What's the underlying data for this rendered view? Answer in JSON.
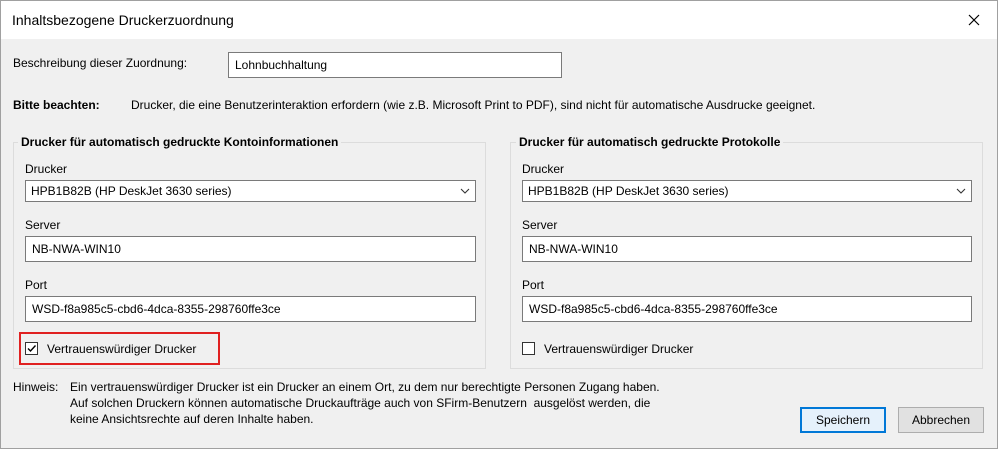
{
  "window": {
    "title": "Inhaltsbezogene Druckerzuordnung",
    "close_glyph": "✕"
  },
  "description": {
    "label": "Beschreibung dieser Zuordnung:",
    "value": "Lohnbuchhaltung"
  },
  "notice": {
    "label": "Bitte beachten:",
    "text": "Drucker, die eine Benutzerinteraktion erfordern (wie z.B. Microsoft Print to PDF), sind nicht für automatische Ausdrucke geeignet."
  },
  "groups": [
    {
      "title": "Drucker für automatisch gedruckte Kontoinformationen",
      "printer_label": "Drucker",
      "printer_value": "HPB1B82B (HP DeskJet 3630 series)",
      "server_label": "Server",
      "server_value": "NB-NWA-WIN10",
      "port_label": "Port",
      "port_value": "WSD-f8a985c5-cbd6-4dca-8355-298760ffe3ce",
      "trusted_label": "Vertrauenswürdiger Drucker",
      "trusted_checked": true
    },
    {
      "title": "Drucker für automatisch gedruckte Protokolle",
      "printer_label": "Drucker",
      "printer_value": "HPB1B82B (HP DeskJet 3630 series)",
      "server_label": "Server",
      "server_value": "NB-NWA-WIN10",
      "port_label": "Port",
      "port_value": "WSD-f8a985c5-cbd6-4dca-8355-298760ffe3ce",
      "trusted_label": "Vertrauenswürdiger Drucker",
      "trusted_checked": false
    }
  ],
  "hint": {
    "label": "Hinweis:",
    "lines": [
      "Ein vertrauenswürdiger Drucker ist ein Drucker an einem Ort, zu dem nur berechtigte Personen Zugang haben.",
      "Auf solchen Druckern können automatische Druckaufträge auch von SFirm-Benutzern  ausgelöst werden, die",
      "keine Ansichtsrechte auf deren Inhalte haben."
    ]
  },
  "buttons": {
    "save": "Speichern",
    "cancel": "Abbrechen"
  },
  "colors": {
    "highlight": "#e02020",
    "primary_border": "#0078d7"
  }
}
